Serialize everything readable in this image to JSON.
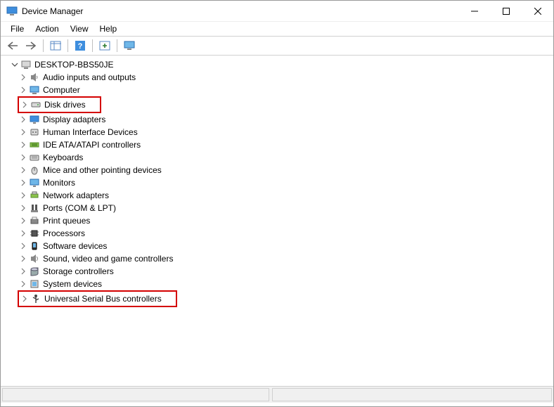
{
  "window": {
    "title": "Device Manager"
  },
  "menu": {
    "file": "File",
    "action": "Action",
    "view": "View",
    "help": "Help"
  },
  "tree": {
    "root_label": "DESKTOP-BBS50JE",
    "items": [
      {
        "label": "Audio inputs and outputs",
        "icon": "speaker"
      },
      {
        "label": "Computer",
        "icon": "computer"
      },
      {
        "label": "Disk drives",
        "icon": "disk",
        "highlight": true
      },
      {
        "label": "Display adapters",
        "icon": "display"
      },
      {
        "label": "Human Interface Devices",
        "icon": "hid"
      },
      {
        "label": "IDE ATA/ATAPI controllers",
        "icon": "ide"
      },
      {
        "label": "Keyboards",
        "icon": "keyboard"
      },
      {
        "label": "Mice and other pointing devices",
        "icon": "mouse"
      },
      {
        "label": "Monitors",
        "icon": "monitor"
      },
      {
        "label": "Network adapters",
        "icon": "network"
      },
      {
        "label": "Ports (COM & LPT)",
        "icon": "port"
      },
      {
        "label": "Print queues",
        "icon": "printer"
      },
      {
        "label": "Processors",
        "icon": "cpu"
      },
      {
        "label": "Software devices",
        "icon": "software"
      },
      {
        "label": "Sound, video and game controllers",
        "icon": "sound"
      },
      {
        "label": "Storage controllers",
        "icon": "storage"
      },
      {
        "label": "System devices",
        "icon": "system"
      },
      {
        "label": "Universal Serial Bus controllers",
        "icon": "usb",
        "highlight": true
      }
    ]
  }
}
